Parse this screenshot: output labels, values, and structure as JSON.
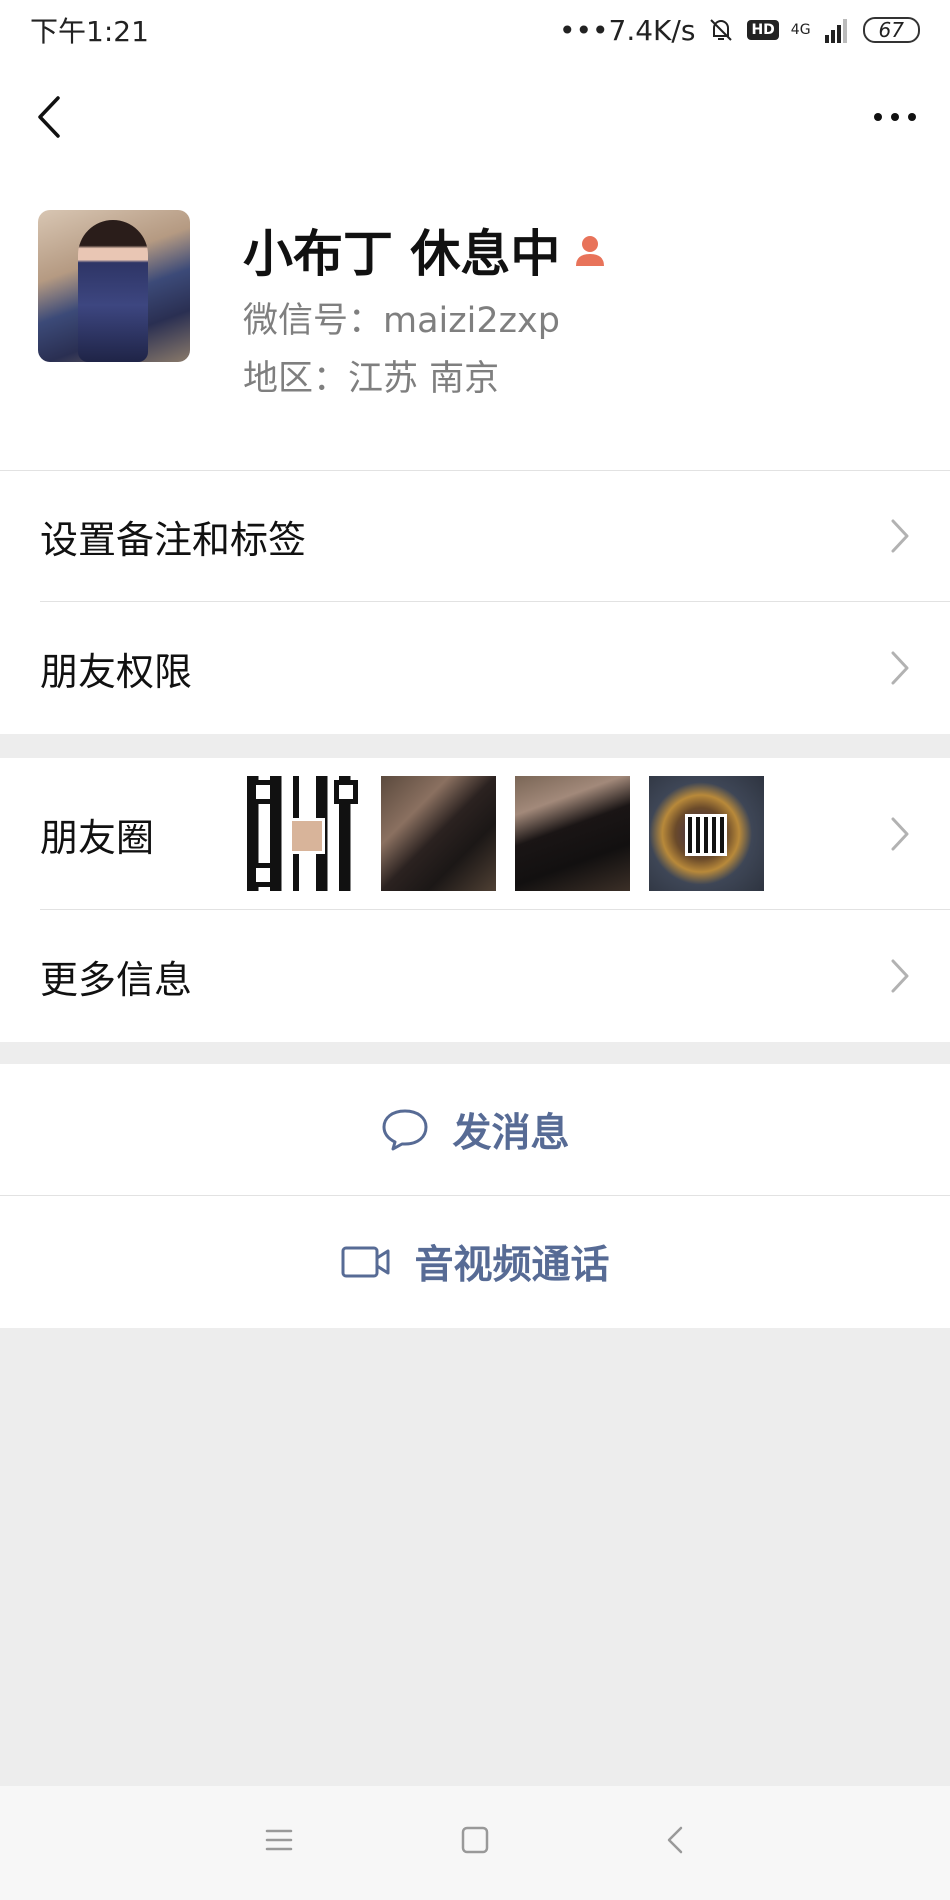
{
  "status_bar": {
    "time": "下午1:21",
    "speed": "•••7.4K/s",
    "hd": "HD",
    "network": "4G",
    "battery": "67"
  },
  "profile": {
    "name": "小布丁 休息中",
    "wechat_id": "微信号：maizi2zxp",
    "region": "地区：江苏  南京"
  },
  "menu": {
    "remark_tags": "设置备注和标签",
    "friend_permissions": "朋友权限",
    "moments": "朋友圈",
    "more_info": "更多信息"
  },
  "actions": {
    "send_message": "发消息",
    "video_call": "音视频通话"
  },
  "colors": {
    "link_blue": "#576b95",
    "badge_orange": "#e8735a"
  }
}
